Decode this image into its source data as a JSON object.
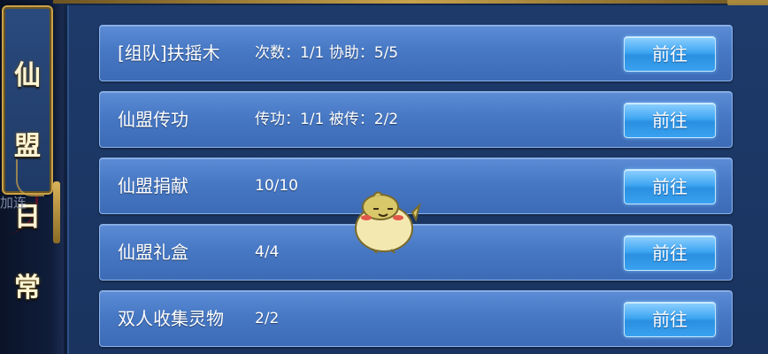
{
  "panel": {
    "title_chars": [
      "仙",
      "盟",
      "日",
      "常"
    ],
    "side_fragment": "加连"
  },
  "tasks": [
    {
      "name": "[组队]扶摇木",
      "progress": "次数：1/1 协助：5/5",
      "button": "前往"
    },
    {
      "name": "仙盟传功",
      "progress": "传功：1/1 被传：2/2",
      "button": "前往"
    },
    {
      "name": "仙盟捐献",
      "progress": "10/10",
      "button": "前往"
    },
    {
      "name": "仙盟礼盒",
      "progress": "4/4",
      "button": "前往"
    },
    {
      "name": "双人收集灵物",
      "progress": "2/2",
      "button": "前往"
    }
  ],
  "colors": {
    "row": "#4778c4",
    "button": "#3fa6f2",
    "plaque_border": "#c9a14a"
  },
  "icons": {
    "mascot": "yellow-chick-mascot-icon"
  }
}
